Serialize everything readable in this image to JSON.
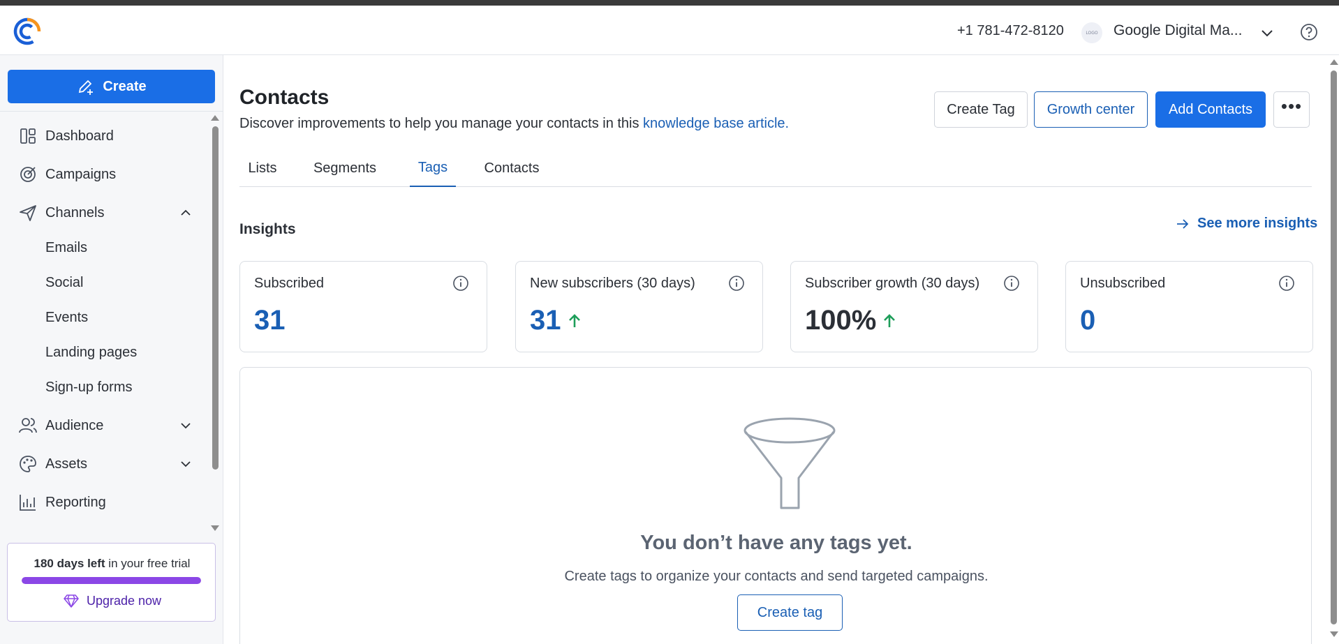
{
  "header": {
    "phone": "+1 781-472-8120",
    "account_logo_text": "LOGO",
    "account_name": "Google Digital Ma...",
    "logo_icon": "constant-contact-logo",
    "help_icon": "question-circle-icon"
  },
  "sidebar": {
    "create_label": "Create",
    "items": [
      {
        "label": "Dashboard",
        "icon": "dashboard-icon"
      },
      {
        "label": "Campaigns",
        "icon": "campaigns-icon"
      },
      {
        "label": "Channels",
        "icon": "paper-plane-icon",
        "expanded": true
      },
      {
        "label": "Emails"
      },
      {
        "label": "Social"
      },
      {
        "label": "Events"
      },
      {
        "label": "Landing pages"
      },
      {
        "label": "Sign-up forms"
      },
      {
        "label": "Audience",
        "icon": "people-icon",
        "expanded": false
      },
      {
        "label": "Assets",
        "icon": "palette-icon",
        "expanded": false
      },
      {
        "label": "Reporting",
        "icon": "chart-icon"
      }
    ],
    "trial": {
      "days_bold": "180 days left",
      "rest": " in your free trial",
      "progress": 1.0,
      "upgrade_label": "Upgrade now"
    }
  },
  "main": {
    "title": "Contacts",
    "subtitle": "Discover improvements to help you manage your contacts in this ",
    "subtitle_link": "knowledge base article.",
    "buttons": {
      "create_tag": "Create Tag",
      "growth_center": "Growth center",
      "add_contacts": "Add Contacts",
      "more": "•••"
    },
    "tabs": [
      {
        "label": "Lists",
        "active": false
      },
      {
        "label": "Segments",
        "active": false
      },
      {
        "label": "Tags",
        "active": true
      },
      {
        "label": "Contacts",
        "active": false
      }
    ],
    "insights": {
      "title": "Insights",
      "see_more": "See more insights",
      "cards": [
        {
          "title": "Subscribed",
          "value": "31",
          "trend": null
        },
        {
          "title": "New subscribers (30 days)",
          "value": "31",
          "trend": "up"
        },
        {
          "title": "Subscriber growth (30 days)",
          "value": "100%",
          "trend": "up"
        },
        {
          "title": "Unsubscribed",
          "value": "0",
          "trend": null
        }
      ]
    },
    "empty": {
      "icon": "funnel-icon",
      "title": "You don’t have any tags yet.",
      "subtitle": "Create tags to organize your contacts and send targeted campaigns.",
      "button": "Create tag"
    }
  },
  "colors": {
    "primary": "#1a6ee6",
    "link": "#1a5fb4",
    "trend_up": "#1e9e5a",
    "trial_purple": "#8b47e6"
  }
}
